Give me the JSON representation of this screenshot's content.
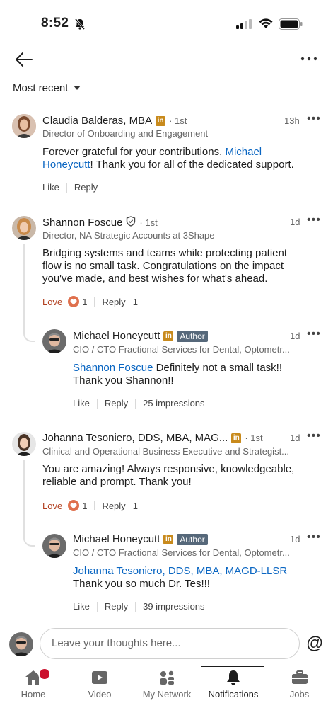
{
  "status_bar": {
    "time": "8:52"
  },
  "sort": {
    "label": "Most recent"
  },
  "comments": [
    {
      "name": "Claudia Balderas, MBA",
      "degree": "· 1st",
      "headline": "Director of Onboarding and Engagement",
      "time": "13h",
      "text_before": "Forever grateful for your contributions, ",
      "mention": "Michael Honeycutt",
      "text_after": "! Thank you for all of the dedicated support.",
      "like": "Like",
      "reply": "Reply"
    },
    {
      "name": "Shannon Foscue",
      "degree": "· 1st",
      "headline": "Director, NA Strategic Accounts at 3Shape",
      "time": "1d",
      "text": "Bridging systems and teams while protecting patient flow is no small task. Congratulations on the impact you've made, and best wishes for what's ahead.",
      "reaction": "Love",
      "reaction_count": "1",
      "reply": "Reply",
      "reply_count": "1",
      "replies": [
        {
          "name": "Michael Honeycutt",
          "author_tag": "Author",
          "headline": "CIO / CTO Fractional Services for Dental, Optometr...",
          "time": "1d",
          "mention": "Shannon Foscue",
          "text": " Definitely not a small task!! Thank you Shannon!!",
          "like": "Like",
          "reply": "Reply",
          "impressions": "25 impressions"
        }
      ]
    },
    {
      "name": "Johanna Tesoniero, DDS, MBA, MAG...",
      "degree": "· 1st",
      "headline": "Clinical and Operational Business Executive and Strategist...",
      "time": "1d",
      "text": "You are amazing! Always responsive, knowledgeable, reliable and prompt. Thank you!",
      "reaction": "Love",
      "reaction_count": "1",
      "reply": "Reply",
      "reply_count": "1",
      "replies": [
        {
          "name": "Michael Honeycutt",
          "author_tag": "Author",
          "headline": "CIO / CTO Fractional Services for Dental, Optometr...",
          "time": "1d",
          "mention": "Johanna Tesoniero, DDS, MBA, MAGD-LLSR",
          "text": "Thank you so much Dr. Tes!!!",
          "like": "Like",
          "reply": "Reply",
          "impressions": "39 impressions"
        }
      ]
    }
  ],
  "input": {
    "placeholder": "Leave your thoughts here...",
    "at_symbol": "@"
  },
  "nav": [
    {
      "label": "Home",
      "icon": "home-icon"
    },
    {
      "label": "Video",
      "icon": "video-icon"
    },
    {
      "label": "My Network",
      "icon": "network-icon"
    },
    {
      "label": "Notifications",
      "icon": "bell-icon",
      "active": true
    },
    {
      "label": "Jobs",
      "icon": "briefcase-icon"
    }
  ],
  "colors": {
    "mention": "#0a66c2",
    "love": "#b24020",
    "linkedin_premium": "#c88a1c",
    "badge": "#cb112d"
  }
}
